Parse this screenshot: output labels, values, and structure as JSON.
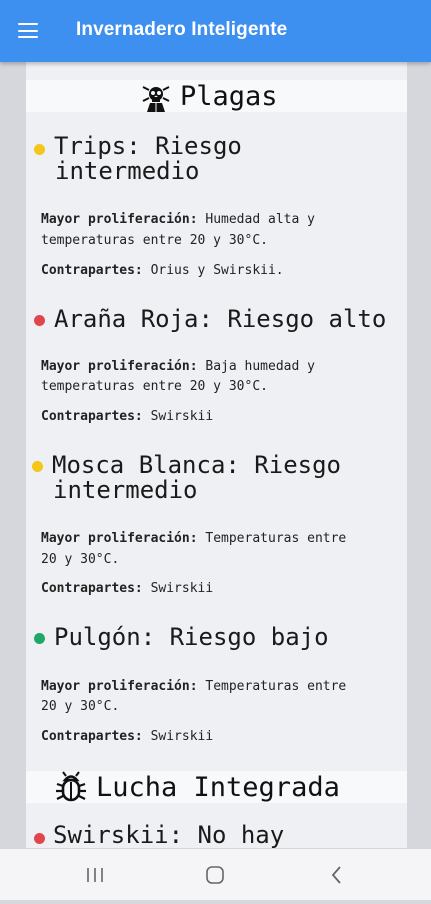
{
  "app": {
    "title": "Invernadero Inteligente"
  },
  "plagas": {
    "heading": "Plagas",
    "icon": "bug-skull-icon",
    "items": [
      {
        "title_line1": "Trips: Riesgo",
        "title_line2": "intermedio",
        "risk_color": "#f5c518",
        "prolif_label": "Mayor proliferación:",
        "prolif_line1": " Humedad alta y",
        "prolif_line2": "temperaturas entre 20 y 30°C.",
        "contra_label": "Contrapartes:",
        "contra_value": " Orius y Swirskii."
      },
      {
        "title_line1": "Araña Roja: Riesgo alto",
        "risk_color": "#e0474c",
        "prolif_label": "Mayor proliferación:",
        "prolif_line1": " Baja humedad y",
        "prolif_line2": "temperaturas entre 20 y 30°C.",
        "contra_label": "Contrapartes:",
        "contra_value": " Swirskii"
      },
      {
        "title_line1": "Mosca Blanca: Riesgo",
        "title_line2": "intermedio",
        "risk_color": "#f5c518",
        "prolif_label": "Mayor proliferación:",
        "prolif_line1": " Temperaturas entre",
        "prolif_line2": "20 y 30°C.",
        "contra_label": "Contrapartes:",
        "contra_value": " Swirskii"
      },
      {
        "title_line1": "Pulgón: Riesgo bajo",
        "risk_color": "#1fa866",
        "prolif_label": "Mayor proliferación:",
        "prolif_line1": " Temperaturas entre",
        "prolif_line2": "20 y 30°C.",
        "contra_label": "Contrapartes:",
        "contra_value": " Swirskii"
      }
    ]
  },
  "lucha": {
    "heading": "Lucha Integrada",
    "icon": "bug-icon",
    "items": [
      {
        "title_line1": "Swirskii: No hay",
        "risk_color": "#e0474c"
      }
    ]
  },
  "navbar": {
    "icons": [
      "recent-apps-icon",
      "home-icon",
      "back-icon"
    ]
  }
}
